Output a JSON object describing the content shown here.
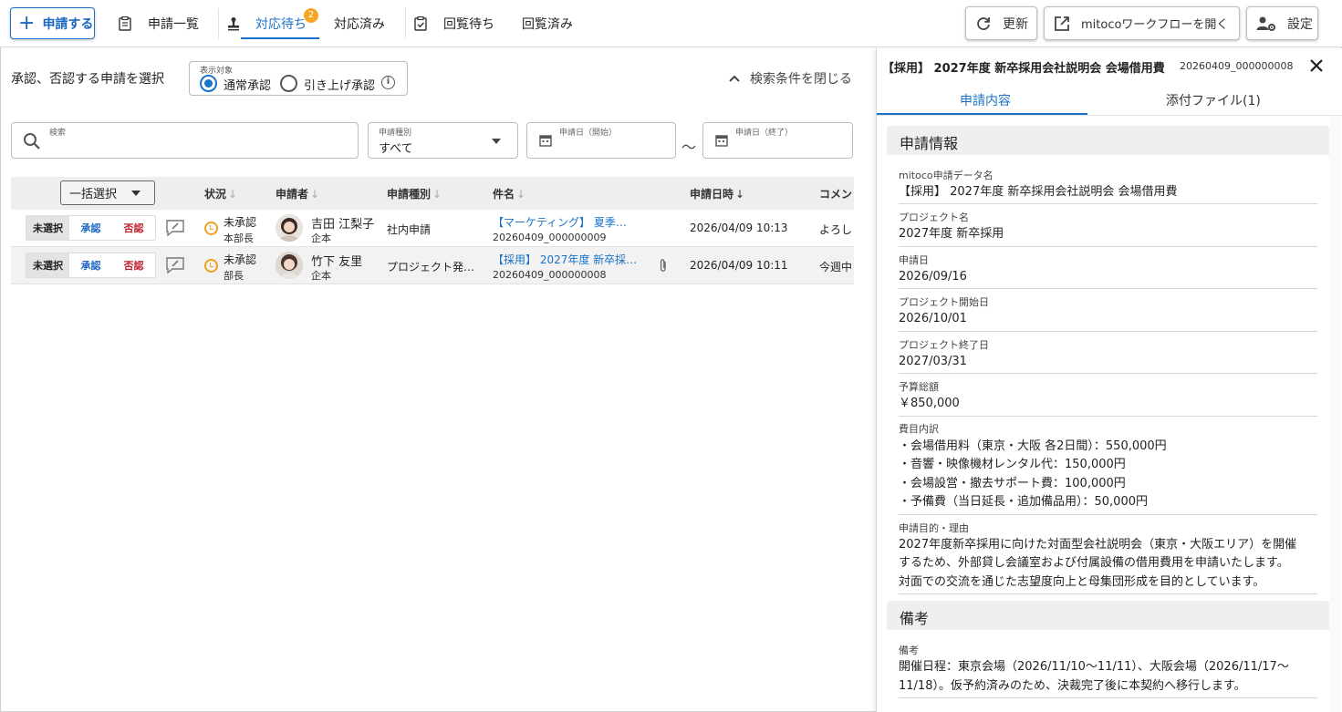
{
  "toolbar": {
    "new_label": "申請する",
    "tabs": [
      {
        "label": "申請一覧"
      },
      {
        "label": "対応待ち",
        "badge": "2"
      },
      {
        "label": "対応済み"
      },
      {
        "label": "回覧待ち"
      },
      {
        "label": "回覧済み"
      }
    ],
    "refresh_label": "更新",
    "open_workflow_label": "mitocoワークフローを開く",
    "settings_label": "設定"
  },
  "search": {
    "heading": "承認、否認する申請を選択",
    "target_legend": "表示対象",
    "radio_normal": "通常承認",
    "radio_pullup": "引き上げ承認",
    "close_label": "検索条件を閉じる",
    "search_label": "検索",
    "type_label": "申請種別",
    "type_value": "すべて",
    "date_start_label": "申請日（開始）",
    "date_end_label": "申請日（終了）",
    "tilde": "～"
  },
  "table": {
    "bulk_label": "一括選択",
    "headers": {
      "status": "状況",
      "applicant": "申請者",
      "type": "申請種別",
      "subject": "件名",
      "datetime": "申請日時",
      "comment": "コメン"
    },
    "rows": [
      {
        "decision": [
          "未選択",
          "承認",
          "否認"
        ],
        "status": "未承認",
        "status_sub": "本部長",
        "name": "吉田 江梨子",
        "company": "企本",
        "type": "社内申請",
        "subject": "【マーケティング】 夏季…",
        "subject_id": "20260409_000000009",
        "datetime": "2026/04/09 10:13",
        "comment": "よろし"
      },
      {
        "decision": [
          "未選択",
          "承認",
          "否認"
        ],
        "status": "未承認",
        "status_sub": "部長",
        "name": "竹下 友里",
        "company": "企本",
        "type": "プロジェクト発…",
        "subject": "【採用】 2027年度 新卒採…",
        "subject_id": "20260409_000000008",
        "datetime": "2026/04/09 10:11",
        "comment": "今週中"
      }
    ]
  },
  "detail": {
    "title": "【採用】 2027年度 新卒採用会社説明会 会場借用費",
    "id": "20260409_000000008",
    "tab_content": "申請内容",
    "tab_attach": "添付ファイル(1)",
    "section_info": "申請情報",
    "fields": [
      {
        "label": "mitoco申請データ名",
        "lines": [
          "【採用】 2027年度 新卒採用会社説明会 会場借用費"
        ]
      },
      {
        "label": "プロジェクト名",
        "lines": [
          "2027年度 新卒採用"
        ]
      },
      {
        "label": "申請日",
        "lines": [
          "2026/09/16"
        ]
      },
      {
        "label": "プロジェクト開始日",
        "lines": [
          "2026/10/01"
        ]
      },
      {
        "label": "プロジェクト終了日",
        "lines": [
          "2027/03/31"
        ]
      },
      {
        "label": "予算総額",
        "lines": [
          "￥850,000"
        ]
      },
      {
        "label": "費目内訳",
        "lines": [
          "・会場借用料（東京・大阪 各2日間）：550,000円",
          "・音響・映像機材レンタル代：150,000円",
          "・会場設営・撤去サポート費：100,000円",
          "・予備費（当日延長・追加備品用）：50,000円"
        ]
      },
      {
        "label": "申請目的・理由",
        "lines": [
          "2027年度新卒採用に向けた対面型会社説明会（東京・大阪エリア）を開催",
          "するため、外部貸し会議室および付属設備の借用費用を申請いたします。",
          "対面での交流を通じた志望度向上と母集団形成を目的としています。"
        ]
      }
    ],
    "section_notes": "備考",
    "notes_label": "備考",
    "notes_lines": [
      "開催日程：東京会場（2026/11/10～11/11）、大阪会場（2026/11/17～",
      "11/18）。仮予約済みのため、決裁完了後に本契約へ移行します。"
    ]
  },
  "colors": {
    "accent": "#1a73c8",
    "reject": "#c2202c",
    "pending": "#f0a020",
    "badge": "#f5a623"
  }
}
